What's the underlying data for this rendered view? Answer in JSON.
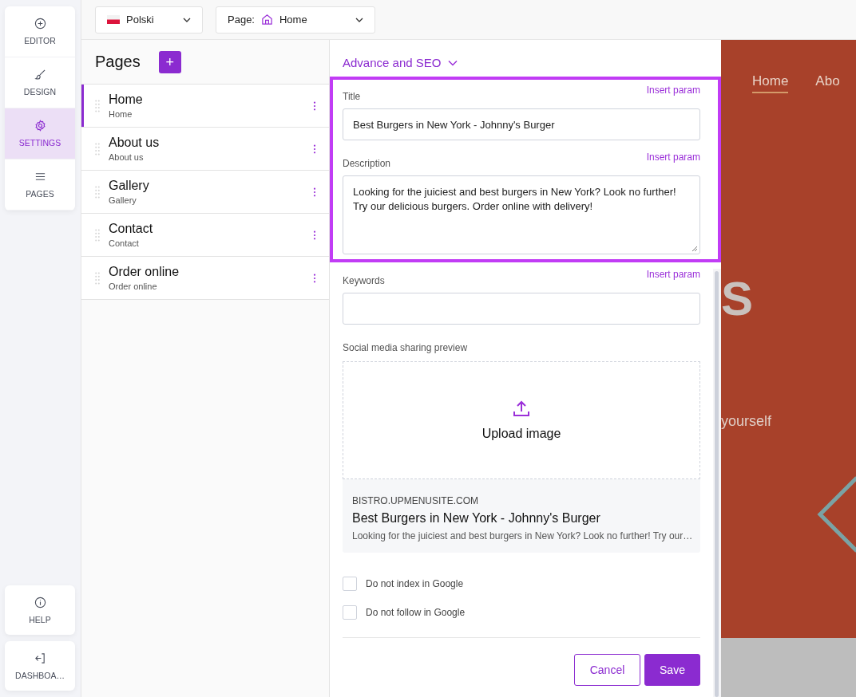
{
  "rail": {
    "items": [
      {
        "kind": "editor",
        "label": "EDITOR",
        "selected": false
      },
      {
        "kind": "design",
        "label": "DESIGN",
        "selected": false
      },
      {
        "kind": "settings",
        "label": "SETTINGS",
        "selected": true
      },
      {
        "kind": "pages",
        "label": "PAGES",
        "selected": false
      }
    ],
    "bottom": [
      {
        "kind": "help",
        "label": "HELP"
      },
      {
        "kind": "dashboard",
        "label": "DASHBOA…"
      }
    ]
  },
  "topbar": {
    "language": {
      "value": "Polski"
    },
    "page": {
      "label": "Page:",
      "value": "Home"
    }
  },
  "pages": {
    "title": "Pages",
    "add_button": "+",
    "items": [
      {
        "name": "Home",
        "slug": "Home",
        "selected": true
      },
      {
        "name": "About us",
        "slug": "About us",
        "selected": false
      },
      {
        "name": "Gallery",
        "slug": "Gallery",
        "selected": false
      },
      {
        "name": "Contact",
        "slug": "Contact",
        "selected": false
      },
      {
        "name": "Order online",
        "slug": "Order online",
        "selected": false
      }
    ]
  },
  "seo": {
    "section_title": "Advance and SEO",
    "expanded": true,
    "fields": [
      {
        "kind": "input",
        "label": "Title",
        "action": "Insert param",
        "value": "Best Burgers in New York - Johnny's Burger",
        "highlighted": true
      },
      {
        "kind": "textarea",
        "label": "Description",
        "action": "Insert param",
        "value": "Looking for the juiciest and best burgers in New York? Look no further! Try our delicious burgers. Order online with delivery!",
        "highlighted": true
      },
      {
        "kind": "input",
        "label": "Keywords",
        "action": "Insert param",
        "highlighted": false
      }
    ]
  },
  "social_preview": {
    "label": "Social media sharing preview",
    "upload": "Upload image",
    "domain": "BISTRO.UPMENUSITE.COM",
    "title": "Best Burgers in New York - Johnny's Burger",
    "description": "Looking for the juiciest and best burgers in New York? Look no further! Try our…"
  },
  "options": [
    {
      "label": "Do not index in Google",
      "checked": false
    },
    {
      "label": "Do not follow in Google",
      "checked": false
    }
  ],
  "buttons": [
    {
      "kind": "secondary",
      "label": "Cancel"
    },
    {
      "kind": "primary",
      "label": "Save"
    }
  ],
  "preview": {
    "nav": [
      {
        "label": "Home",
        "selected": true
      },
      {
        "label": "Abo",
        "selected": false
      }
    ],
    "heading": "S",
    "tagline": "yourself"
  }
}
